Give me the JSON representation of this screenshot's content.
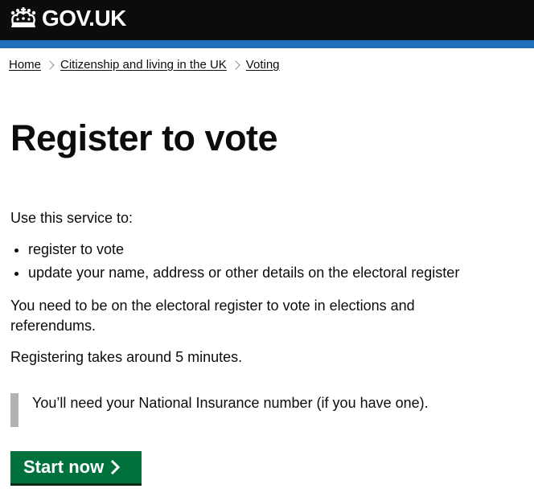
{
  "header": {
    "logo_text": "GOV.UK",
    "logo_icon": "crown-icon",
    "bar_color": "#1d70b8"
  },
  "breadcrumbs": [
    {
      "label": "Home"
    },
    {
      "label": "Citizenship and living in the UK"
    },
    {
      "label": "Voting"
    }
  ],
  "page": {
    "title": "Register to vote",
    "intro": "Use this service to:",
    "bullets": [
      "register to vote",
      "update your name, address or other details on the electoral register"
    ],
    "para1": "You need to be on the electoral register to vote in elections and referendums.",
    "para2": "Registering takes around 5 minutes.",
    "inset": "You’ll need your National Insurance number (if you have one)."
  },
  "start_button": {
    "label": "Start now",
    "icon": "chevron-right-icon",
    "color": "#00703c"
  }
}
